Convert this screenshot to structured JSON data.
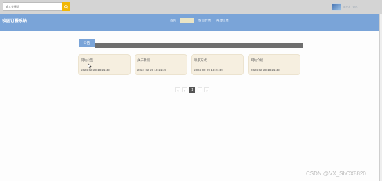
{
  "search": {
    "placeholder": "输入关键词",
    "button_icon": "search-icon"
  },
  "user": {
    "name": "用户名",
    "logout": "退出"
  },
  "site": {
    "title": "校园订餐系统"
  },
  "nav": {
    "items": [
      {
        "label": "首页",
        "active": false
      },
      {
        "label": "公告",
        "active": true
      },
      {
        "label": "留言反馈",
        "active": false
      },
      {
        "label": "商品信息",
        "active": false
      }
    ]
  },
  "section": {
    "title": "公告"
  },
  "cards": [
    {
      "title": "网站公告",
      "time": "2024-02-29 18:21:49"
    },
    {
      "title": "关于我们",
      "time": "2024-02-29 18:21:49"
    },
    {
      "title": "联系方式",
      "time": "2024-02-29 18:21:49"
    },
    {
      "title": "网站介绍",
      "time": "2024-02-29 18:21:49"
    }
  ],
  "pagination": {
    "first": "«",
    "prev": "‹",
    "current": "1",
    "next": "›",
    "last": "»"
  },
  "watermark": "CSDN @VX_ShCX8820",
  "colors": {
    "navbar": "#7aa4d8",
    "topbar": "#d4d4d4",
    "search_button": "#f2b705",
    "card": "#f6efe0",
    "section_bar": "#6e6e6e"
  }
}
